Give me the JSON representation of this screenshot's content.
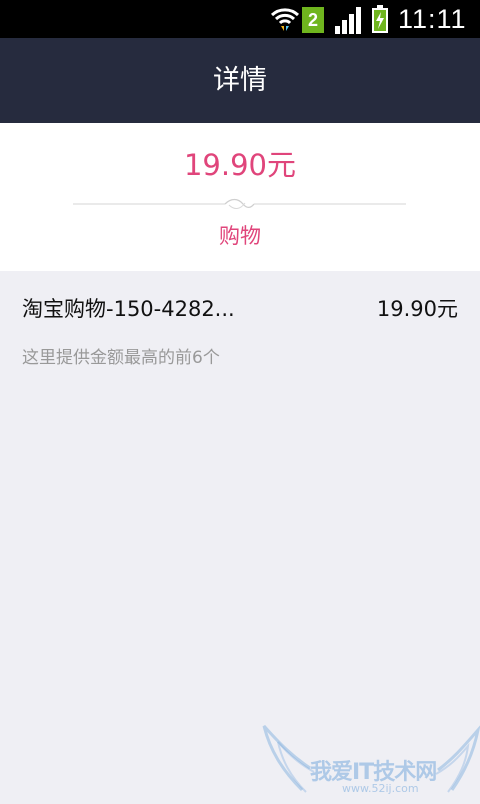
{
  "status_bar": {
    "sim_slot": "2",
    "time": "11:11",
    "icons": [
      "wifi-icon",
      "sim-2-icon",
      "signal-icon",
      "battery-charging-icon"
    ]
  },
  "header": {
    "title": "详情"
  },
  "summary": {
    "amount": "19.90元",
    "category": "购物"
  },
  "transactions": [
    {
      "title": "淘宝购物-150-4282...",
      "amount": "19.90元"
    }
  ],
  "hint": "这里提供金额最高的前6个",
  "watermark": {
    "text": "我爱IT技术网",
    "url": "www.52ij.com"
  },
  "colors": {
    "status_bar": "#000000",
    "title_bar": "#262b3e",
    "accent": "#e0457b",
    "background": "#efeff4",
    "card": "#ffffff",
    "sim_badge": "#6fb51e"
  }
}
